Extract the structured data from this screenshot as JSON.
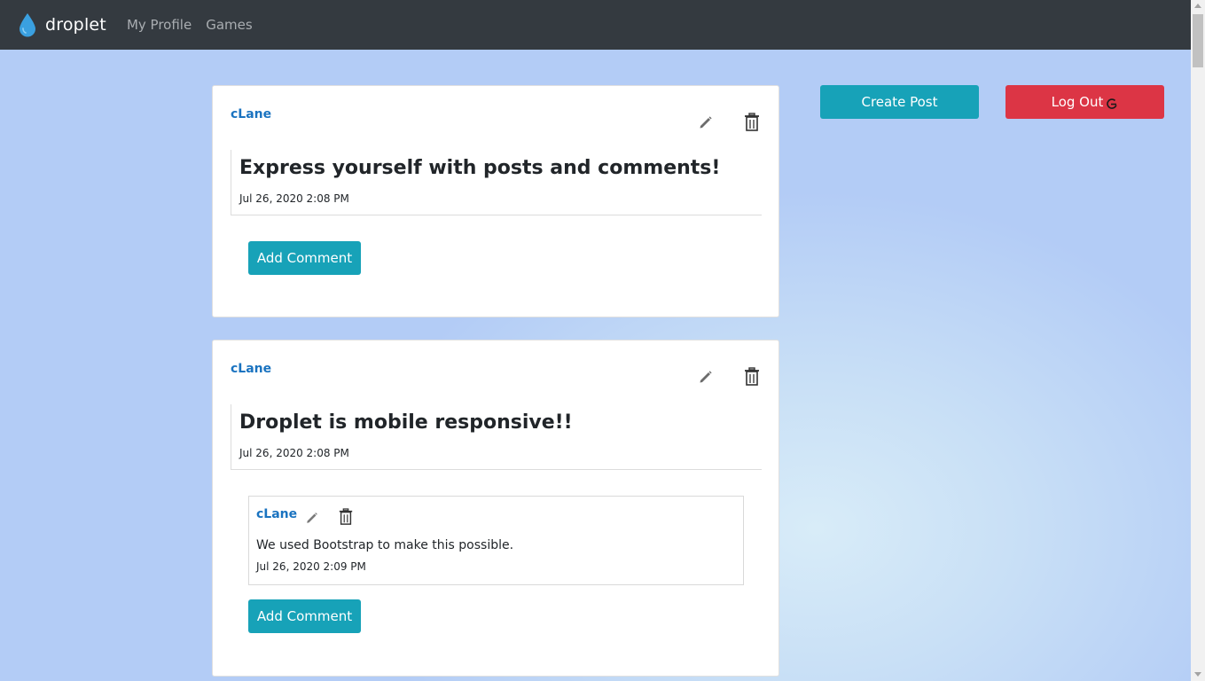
{
  "nav": {
    "brand": "droplet",
    "links": [
      "My Profile",
      "Games"
    ]
  },
  "actions": {
    "create_post": "Create Post",
    "log_out": "Log Out"
  },
  "posts": [
    {
      "author": "cLane",
      "title": "Express yourself with posts and comments!",
      "time": "Jul 26, 2020 2:08 PM",
      "comments": [],
      "add_comment": "Add Comment"
    },
    {
      "author": "cLane",
      "title": "Droplet is mobile responsive!!",
      "time": "Jul 26, 2020 2:08 PM",
      "comments": [
        {
          "author": "cLane",
          "text": "We used Bootstrap to make this possible.",
          "time": "Jul 26, 2020 2:09 PM"
        }
      ],
      "add_comment": "Add Comment"
    }
  ],
  "colors": {
    "navbar": "#343a40",
    "info": "#17a2b8",
    "danger": "#dc3545",
    "link": "#1a73c0"
  }
}
